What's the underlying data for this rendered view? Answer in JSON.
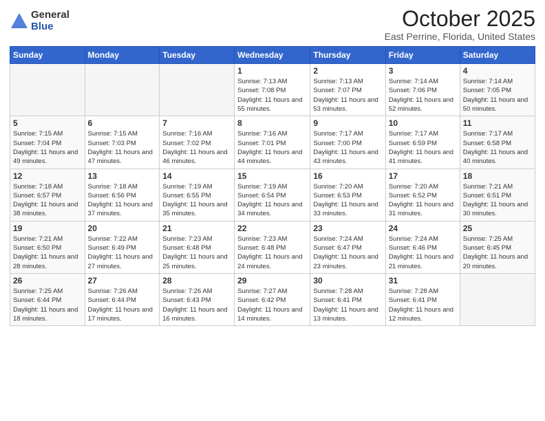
{
  "logo": {
    "general": "General",
    "blue": "Blue"
  },
  "header": {
    "month": "October 2025",
    "location": "East Perrine, Florida, United States"
  },
  "days_of_week": [
    "Sunday",
    "Monday",
    "Tuesday",
    "Wednesday",
    "Thursday",
    "Friday",
    "Saturday"
  ],
  "weeks": [
    [
      {
        "day": "",
        "sunrise": "",
        "sunset": "",
        "daylight": "",
        "empty": true
      },
      {
        "day": "",
        "sunrise": "",
        "sunset": "",
        "daylight": "",
        "empty": true
      },
      {
        "day": "",
        "sunrise": "",
        "sunset": "",
        "daylight": "",
        "empty": true
      },
      {
        "day": "1",
        "sunrise": "Sunrise: 7:13 AM",
        "sunset": "Sunset: 7:08 PM",
        "daylight": "Daylight: 11 hours and 55 minutes."
      },
      {
        "day": "2",
        "sunrise": "Sunrise: 7:13 AM",
        "sunset": "Sunset: 7:07 PM",
        "daylight": "Daylight: 11 hours and 53 minutes."
      },
      {
        "day": "3",
        "sunrise": "Sunrise: 7:14 AM",
        "sunset": "Sunset: 7:06 PM",
        "daylight": "Daylight: 11 hours and 52 minutes."
      },
      {
        "day": "4",
        "sunrise": "Sunrise: 7:14 AM",
        "sunset": "Sunset: 7:05 PM",
        "daylight": "Daylight: 11 hours and 50 minutes."
      }
    ],
    [
      {
        "day": "5",
        "sunrise": "Sunrise: 7:15 AM",
        "sunset": "Sunset: 7:04 PM",
        "daylight": "Daylight: 11 hours and 49 minutes."
      },
      {
        "day": "6",
        "sunrise": "Sunrise: 7:15 AM",
        "sunset": "Sunset: 7:03 PM",
        "daylight": "Daylight: 11 hours and 47 minutes."
      },
      {
        "day": "7",
        "sunrise": "Sunrise: 7:16 AM",
        "sunset": "Sunset: 7:02 PM",
        "daylight": "Daylight: 11 hours and 46 minutes."
      },
      {
        "day": "8",
        "sunrise": "Sunrise: 7:16 AM",
        "sunset": "Sunset: 7:01 PM",
        "daylight": "Daylight: 11 hours and 44 minutes."
      },
      {
        "day": "9",
        "sunrise": "Sunrise: 7:17 AM",
        "sunset": "Sunset: 7:00 PM",
        "daylight": "Daylight: 11 hours and 43 minutes."
      },
      {
        "day": "10",
        "sunrise": "Sunrise: 7:17 AM",
        "sunset": "Sunset: 6:59 PM",
        "daylight": "Daylight: 11 hours and 41 minutes."
      },
      {
        "day": "11",
        "sunrise": "Sunrise: 7:17 AM",
        "sunset": "Sunset: 6:58 PM",
        "daylight": "Daylight: 11 hours and 40 minutes."
      }
    ],
    [
      {
        "day": "12",
        "sunrise": "Sunrise: 7:18 AM",
        "sunset": "Sunset: 6:57 PM",
        "daylight": "Daylight: 11 hours and 38 minutes."
      },
      {
        "day": "13",
        "sunrise": "Sunrise: 7:18 AM",
        "sunset": "Sunset: 6:56 PM",
        "daylight": "Daylight: 11 hours and 37 minutes."
      },
      {
        "day": "14",
        "sunrise": "Sunrise: 7:19 AM",
        "sunset": "Sunset: 6:55 PM",
        "daylight": "Daylight: 11 hours and 35 minutes."
      },
      {
        "day": "15",
        "sunrise": "Sunrise: 7:19 AM",
        "sunset": "Sunset: 6:54 PM",
        "daylight": "Daylight: 11 hours and 34 minutes."
      },
      {
        "day": "16",
        "sunrise": "Sunrise: 7:20 AM",
        "sunset": "Sunset: 6:53 PM",
        "daylight": "Daylight: 11 hours and 33 minutes."
      },
      {
        "day": "17",
        "sunrise": "Sunrise: 7:20 AM",
        "sunset": "Sunset: 6:52 PM",
        "daylight": "Daylight: 11 hours and 31 minutes."
      },
      {
        "day": "18",
        "sunrise": "Sunrise: 7:21 AM",
        "sunset": "Sunset: 6:51 PM",
        "daylight": "Daylight: 11 hours and 30 minutes."
      }
    ],
    [
      {
        "day": "19",
        "sunrise": "Sunrise: 7:21 AM",
        "sunset": "Sunset: 6:50 PM",
        "daylight": "Daylight: 11 hours and 28 minutes."
      },
      {
        "day": "20",
        "sunrise": "Sunrise: 7:22 AM",
        "sunset": "Sunset: 6:49 PM",
        "daylight": "Daylight: 11 hours and 27 minutes."
      },
      {
        "day": "21",
        "sunrise": "Sunrise: 7:23 AM",
        "sunset": "Sunset: 6:48 PM",
        "daylight": "Daylight: 11 hours and 25 minutes."
      },
      {
        "day": "22",
        "sunrise": "Sunrise: 7:23 AM",
        "sunset": "Sunset: 6:48 PM",
        "daylight": "Daylight: 11 hours and 24 minutes."
      },
      {
        "day": "23",
        "sunrise": "Sunrise: 7:24 AM",
        "sunset": "Sunset: 6:47 PM",
        "daylight": "Daylight: 11 hours and 23 minutes."
      },
      {
        "day": "24",
        "sunrise": "Sunrise: 7:24 AM",
        "sunset": "Sunset: 6:46 PM",
        "daylight": "Daylight: 11 hours and 21 minutes."
      },
      {
        "day": "25",
        "sunrise": "Sunrise: 7:25 AM",
        "sunset": "Sunset: 6:45 PM",
        "daylight": "Daylight: 11 hours and 20 minutes."
      }
    ],
    [
      {
        "day": "26",
        "sunrise": "Sunrise: 7:25 AM",
        "sunset": "Sunset: 6:44 PM",
        "daylight": "Daylight: 11 hours and 18 minutes."
      },
      {
        "day": "27",
        "sunrise": "Sunrise: 7:26 AM",
        "sunset": "Sunset: 6:44 PM",
        "daylight": "Daylight: 11 hours and 17 minutes."
      },
      {
        "day": "28",
        "sunrise": "Sunrise: 7:26 AM",
        "sunset": "Sunset: 6:43 PM",
        "daylight": "Daylight: 11 hours and 16 minutes."
      },
      {
        "day": "29",
        "sunrise": "Sunrise: 7:27 AM",
        "sunset": "Sunset: 6:42 PM",
        "daylight": "Daylight: 11 hours and 14 minutes."
      },
      {
        "day": "30",
        "sunrise": "Sunrise: 7:28 AM",
        "sunset": "Sunset: 6:41 PM",
        "daylight": "Daylight: 11 hours and 13 minutes."
      },
      {
        "day": "31",
        "sunrise": "Sunrise: 7:28 AM",
        "sunset": "Sunset: 6:41 PM",
        "daylight": "Daylight: 11 hours and 12 minutes."
      },
      {
        "day": "",
        "sunrise": "",
        "sunset": "",
        "daylight": "",
        "empty": true
      }
    ]
  ]
}
